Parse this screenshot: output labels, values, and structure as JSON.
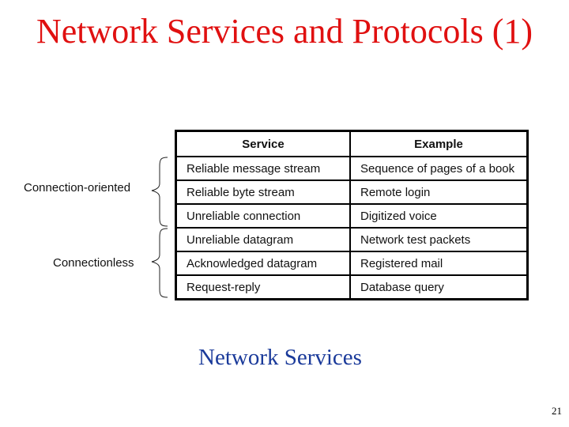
{
  "slide": {
    "title": "Network Services and Protocols (1)",
    "caption": "Network Services",
    "page_number": "21"
  },
  "table": {
    "headers": [
      "Service",
      "Example"
    ],
    "rows": [
      [
        "Reliable message stream",
        "Sequence of pages of a book"
      ],
      [
        "Reliable byte stream",
        "Remote login"
      ],
      [
        "Unreliable connection",
        "Digitized voice"
      ],
      [
        "Unreliable datagram",
        "Network test packets"
      ],
      [
        "Acknowledged datagram",
        "Registered mail"
      ],
      [
        "Request-reply",
        "Database query"
      ]
    ]
  },
  "groups": [
    {
      "label": "Connection-oriented",
      "rows": 3
    },
    {
      "label": "Connectionless",
      "rows": 3
    }
  ],
  "colors": {
    "title": "#e01010",
    "caption": "#1a3a9a"
  }
}
